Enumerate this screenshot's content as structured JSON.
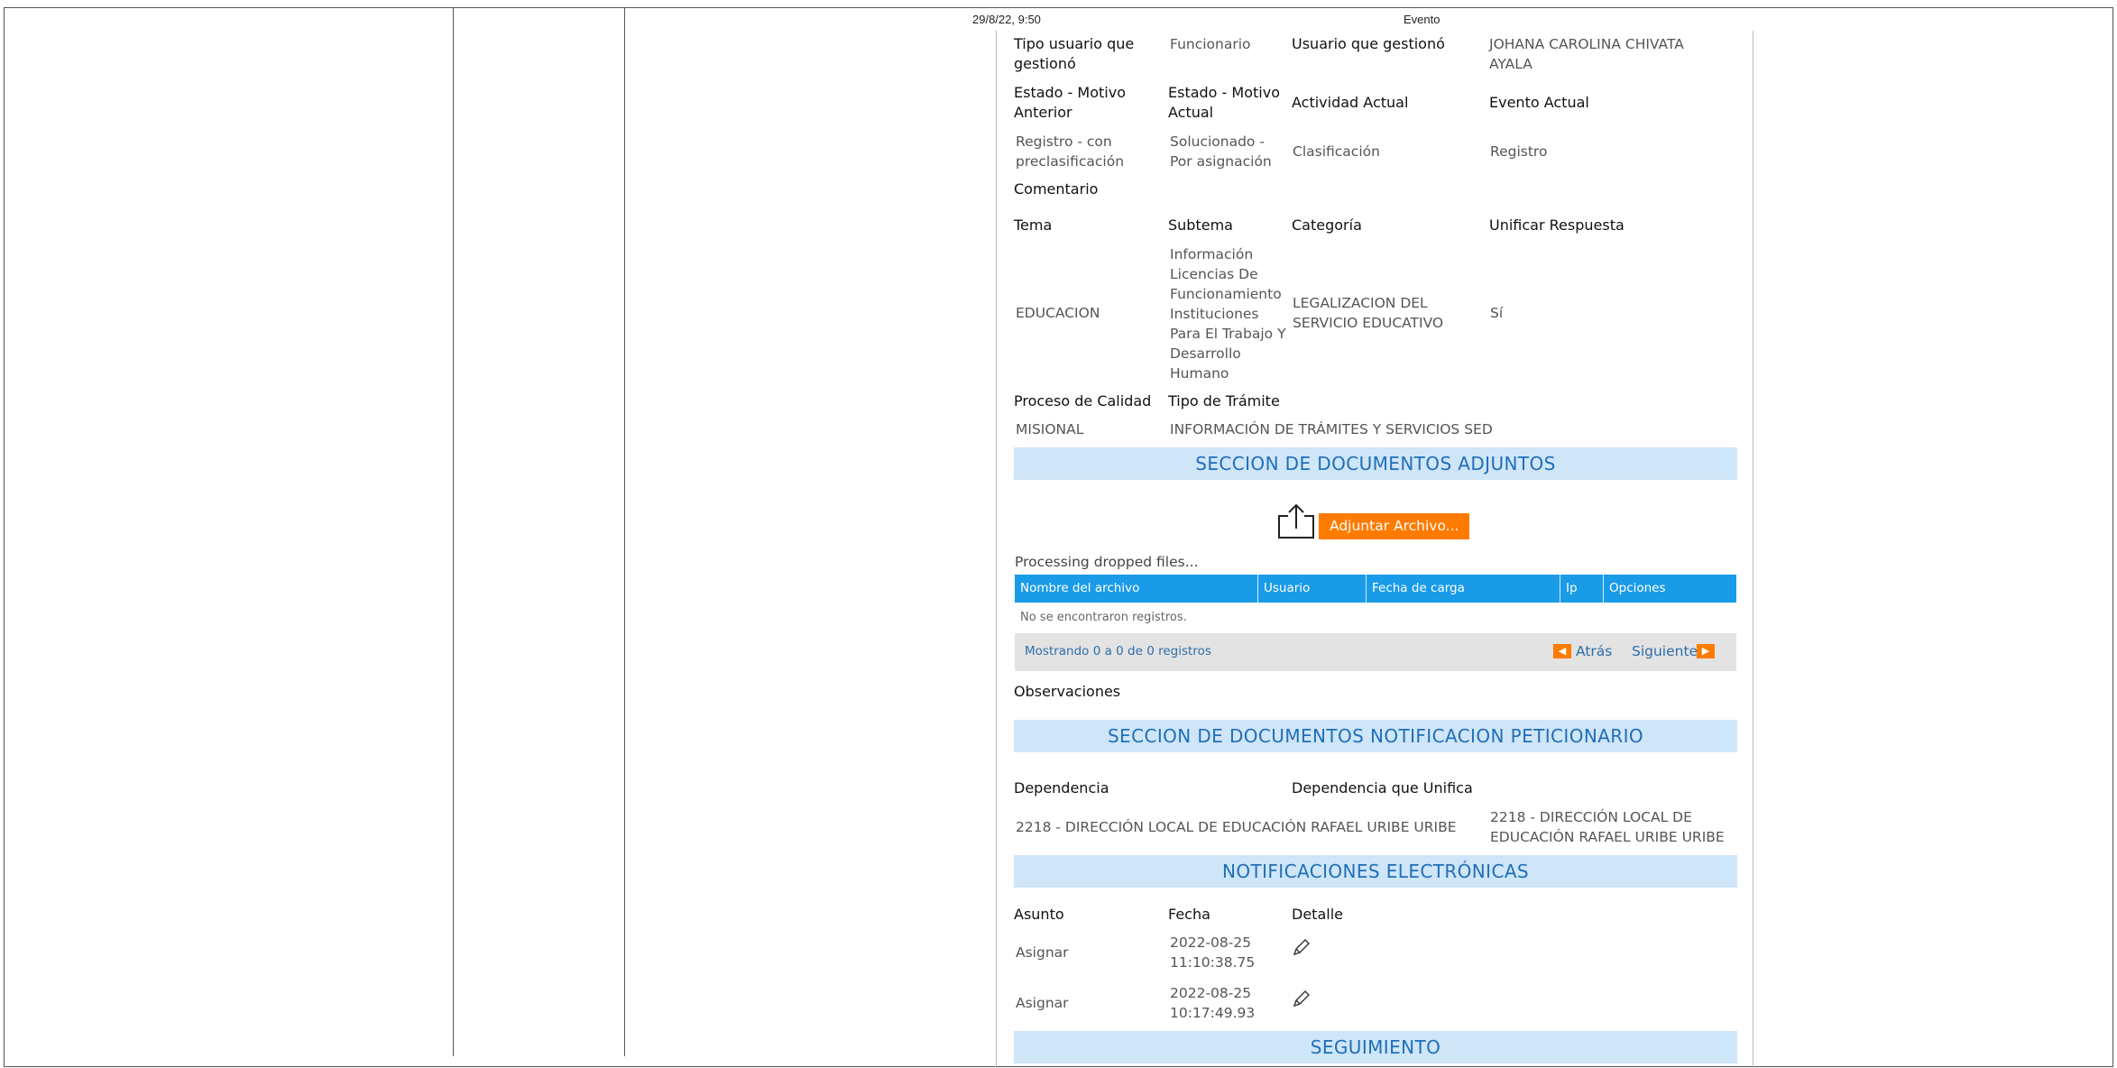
{
  "header": {
    "date": "29/8/22, 9:50",
    "title": "Evento"
  },
  "info": {
    "tipo_usuario_label": "Tipo usuario que gestionó",
    "tipo_usuario_value": "Funcionario",
    "usuario_gestiono_label": "Usuario que gestionó",
    "usuario_gestiono_value": "JOHANA CAROLINA CHIVATA AYALA",
    "estado_anterior_label": "Estado - Motivo Anterior",
    "estado_actual_label": "Estado - Motivo Actual",
    "actividad_actual_label": "Actividad Actual",
    "evento_actual_label": "Evento Actual",
    "estado_anterior_value": "Registro - con preclasificación",
    "estado_actual_value": "Solucionado - Por asignación",
    "actividad_actual_value": "Clasificación",
    "evento_actual_value": "Registro",
    "comentario_label": "Comentario",
    "tema_label": "Tema",
    "subtema_label": "Subtema",
    "categoria_label": "Categoría",
    "unificar_label": "Unificar Respuesta",
    "tema_value": "EDUCACION",
    "subtema_value": "Información Licencias De Funcionamiento Instituciones Para El Trabajo Y Desarrollo Humano",
    "categoria_value": "LEGALIZACION DEL SERVICIO EDUCATIVO",
    "unificar_value": "Sí",
    "proceso_label": "Proceso de Calidad",
    "tipo_tramite_label": "Tipo de Trámite",
    "proceso_value": "MISIONAL",
    "tipo_tramite_value": "INFORMACIÓN DE TRÁMITES Y SERVICIOS SED"
  },
  "attachments": {
    "section_title": "SECCION DE DOCUMENTOS ADJUNTOS",
    "attach_button": "Adjuntar Archivo...",
    "processing": "Processing dropped files...",
    "columns": [
      "Nombre del archivo",
      "Usuario",
      "Fecha de carga",
      "Ip",
      "Opciones"
    ],
    "no_records": "No se encontraron registros.",
    "showing": "Mostrando 0 a 0 de 0 registros",
    "prev": "Atrás",
    "next": "Siguiente",
    "observaciones_label": "Observaciones"
  },
  "notificacion_peticionario": {
    "section_title": "SECCION DE DOCUMENTOS NOTIFICACION PETICIONARIO",
    "dependencia_label": "Dependencia",
    "dependencia_unifica_label": "Dependencia que Unifica",
    "dependencia_value": "2218 - DIRECCIÓN LOCAL DE EDUCACIÓN RAFAEL URIBE URIBE",
    "dependencia_unifica_value": "2218 - DIRECCIÓN LOCAL DE EDUCACIÓN RAFAEL URIBE URIBE"
  },
  "notificaciones": {
    "section_title": "NOTIFICACIONES ELECTRÓNICAS",
    "asunto_label": "Asunto",
    "fecha_label": "Fecha",
    "detalle_label": "Detalle",
    "rows": [
      {
        "asunto": "Asignar",
        "fecha": "2022-08-25 11:10:38.75"
      },
      {
        "asunto": "Asignar",
        "fecha": "2022-08-25 10:17:49.93"
      }
    ]
  },
  "seguimiento": {
    "section_title": "SEGUIMIENTO"
  },
  "colors": {
    "section_bg": "#cfe5f8",
    "section_text": "#1f6fb8",
    "accent": "#ff7b00",
    "table_header": "#1a9be8"
  },
  "icons": {
    "upload": "upload-icon",
    "edit": "pencil-icon",
    "prev": "triangle-left-icon",
    "next": "triangle-right-icon"
  }
}
